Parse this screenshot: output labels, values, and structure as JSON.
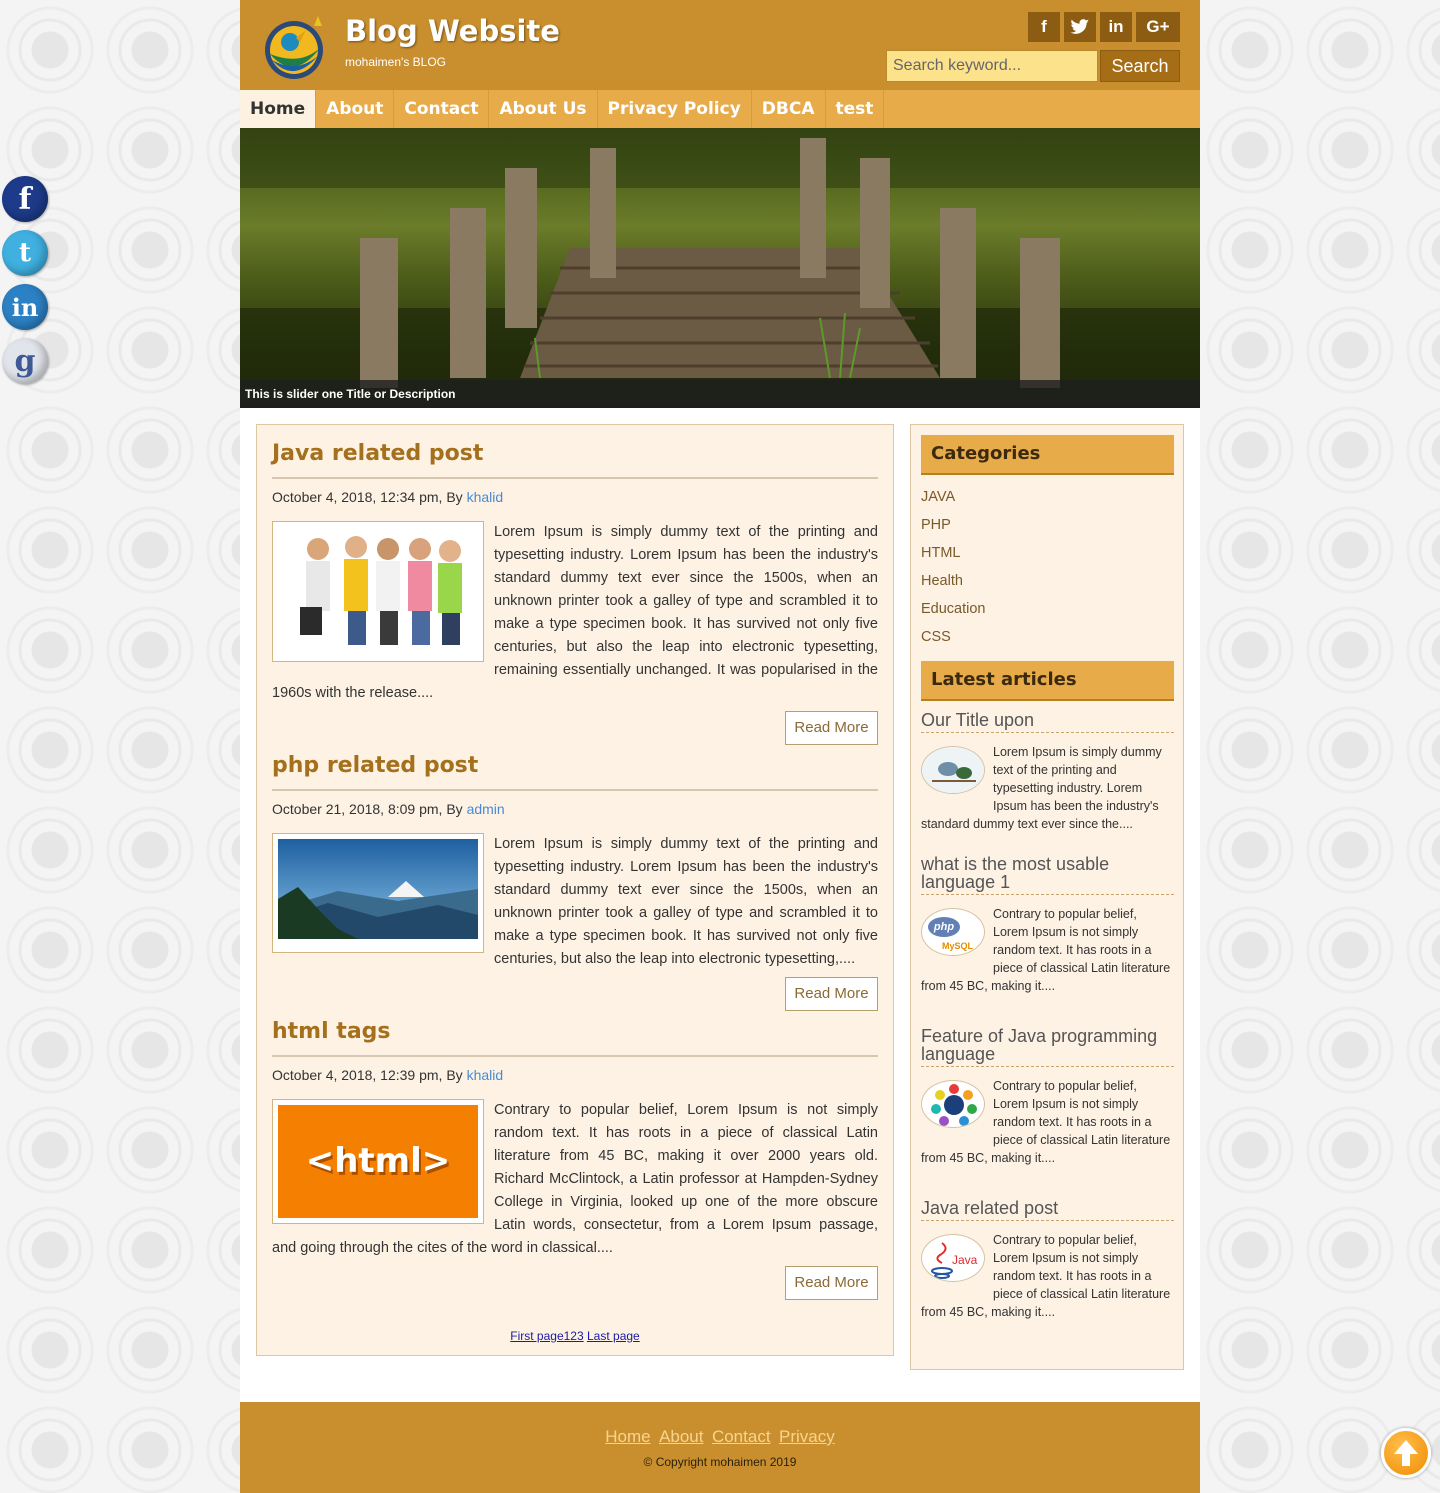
{
  "site": {
    "title": "Blog Website",
    "subtitle": "mohaimen's BLOG"
  },
  "top_social": [
    "f",
    "t",
    "in",
    "G+"
  ],
  "side_social": [
    "f",
    "t",
    "in",
    "g"
  ],
  "search": {
    "placeholder": "Search keyword...",
    "button": "Search"
  },
  "nav": [
    "Home",
    "About",
    "Contact",
    "About Us",
    "Privacy Policy",
    "DBCA",
    "test"
  ],
  "slider": {
    "caption": "This is slider one Title or Description"
  },
  "posts": [
    {
      "title": "Java related post",
      "date": "October 4, 2018, 12:34 pm, By ",
      "author": "khalid",
      "body": "Lorem Ipsum is simply dummy text of the printing and typesetting industry. Lorem Ipsum has been the industry's standard dummy text ever since the 1500s, when an unknown printer took a galley of type and scrambled it to make a type specimen book. It has survived not only five centuries, but also the leap into electronic typesetting, remaining essentially unchanged. It was popularised in the 1960s with the release....",
      "read_more": "Read More"
    },
    {
      "title": "php related post",
      "date": "October 21, 2018, 8:09 pm, By ",
      "author": "admin",
      "body": "Lorem Ipsum is simply dummy text of the printing and typesetting industry. Lorem Ipsum has been the industry's standard dummy text ever since the 1500s, when an unknown printer took a galley of type and scrambled it to make a type specimen book. It has survived not only five centuries, but also the leap into electronic typesetting,....",
      "read_more": "Read More"
    },
    {
      "title": "html tags",
      "date": "October 4, 2018, 12:39 pm, By ",
      "author": "khalid",
      "body": "Contrary to popular belief, Lorem Ipsum is not simply random text. It has roots in a piece of classical Latin literature from 45 BC, making it over 2000 years old. Richard McClintock, a Latin professor at Hampden-Sydney College in Virginia, looked up one of the more obscure Latin words, consectetur, from a Lorem Ipsum passage, and going through the cites of the word in classical....",
      "read_more": "Read More",
      "thumb_text": "<html>"
    }
  ],
  "pager": {
    "first": "First page",
    "pages": "123",
    "last": "Last page"
  },
  "sidebar": {
    "categories_title": "Categories",
    "categories": [
      "JAVA",
      "PHP",
      "HTML",
      "Health",
      "Education",
      "CSS"
    ],
    "latest_title": "Latest articles",
    "articles": [
      {
        "title": "Our Title upon",
        "body": "Lorem Ipsum is simply dummy text of the printing and typesetting industry. Lorem Ipsum has been the industry's standard dummy text ever since the...."
      },
      {
        "title": "what is the most usable language 1",
        "body": "Contrary to popular belief, Lorem Ipsum is not simply random text. It has roots in a piece of classical Latin literature from 45 BC, making it....",
        "icon_text": "php",
        "icon_sub": "MySQL"
      },
      {
        "title": "Feature of Java programming language",
        "body": "Contrary to popular belief, Lorem Ipsum is not simply random text. It has roots in a piece of classical Latin literature from 45 BC, making it...."
      },
      {
        "title": "Java related post",
        "body": "Contrary to popular belief, Lorem Ipsum is not simply random text. It has roots in a piece of classical Latin literature from 45 BC, making it....",
        "icon_text": "Java"
      }
    ]
  },
  "footer": {
    "links": [
      "Home",
      "About",
      "Contact",
      "Privacy"
    ],
    "copyright": "© Copyright mohaimen 2019"
  },
  "colors": {
    "header": "#c98f2e",
    "nav": "#e8ab4a",
    "post_title": "#a5701c",
    "content_bg": "#fdf2e4"
  }
}
